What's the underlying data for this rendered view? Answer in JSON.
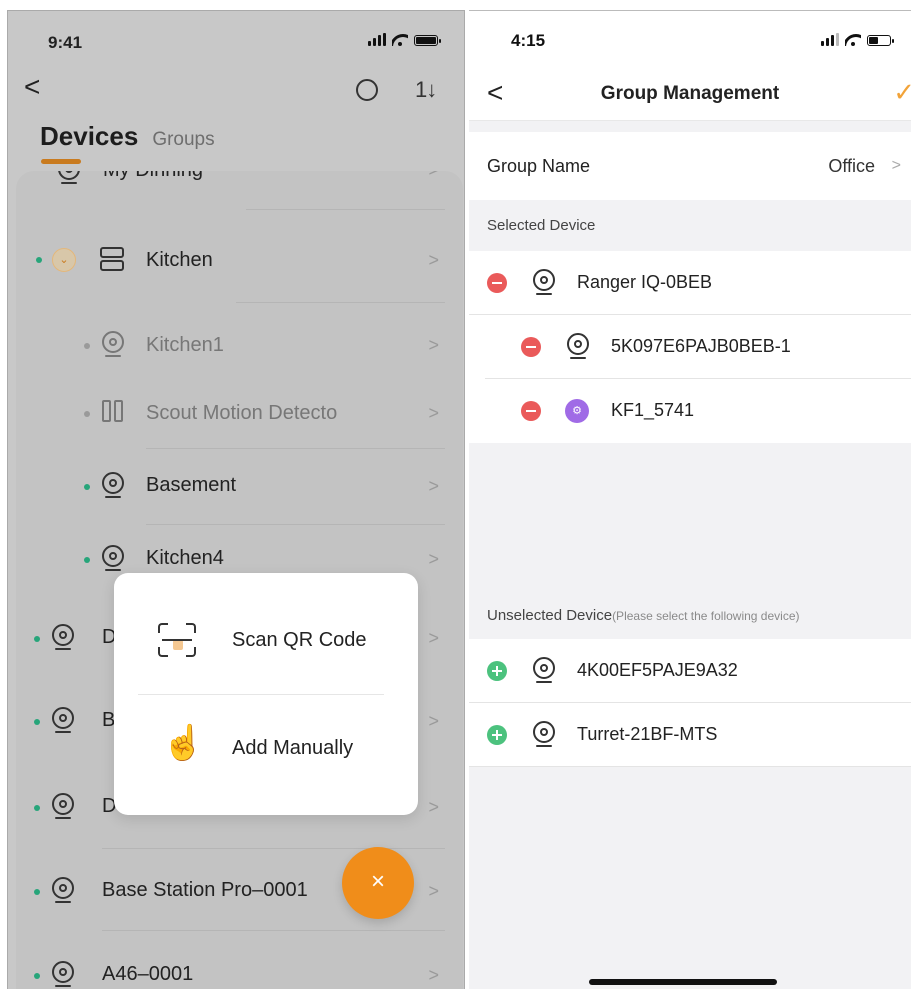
{
  "left": {
    "status": {
      "time": "9:41"
    },
    "nav": {
      "back": "<",
      "sort": "1↓"
    },
    "tabs": {
      "devices": "Devices",
      "groups": "Groups"
    },
    "partial_top_row": "My Dinning",
    "rows": [
      {
        "label": "Kitchen"
      },
      {
        "label": "Kitchen1"
      },
      {
        "label": "Scout Motion Detecto"
      },
      {
        "label": "Basement"
      },
      {
        "label": "Kitchen4"
      },
      {
        "label": "Do"
      },
      {
        "label": "Ba"
      },
      {
        "label": "Do"
      },
      {
        "label": "Base Station Pro–0001"
      },
      {
        "label": "A46–0001"
      }
    ],
    "popup": {
      "scan": "Scan QR Code",
      "manual": "Add Manually"
    },
    "fab": "×"
  },
  "right": {
    "status": {
      "time": "4:15"
    },
    "nav": {
      "back": "<",
      "title": "Group Management",
      "confirm": "✓"
    },
    "group_name": {
      "label": "Group Name",
      "value": "Office",
      "chevron": ">"
    },
    "selected": {
      "heading": "Selected Device",
      "devices": [
        {
          "name": "Ranger IQ-0BEB"
        },
        {
          "name": "5K097E6PAJB0BEB-1"
        },
        {
          "name": "KF1_5741"
        }
      ]
    },
    "unselected": {
      "heading": "Unselected Device",
      "hint": "(Please select the following device)",
      "devices": [
        {
          "name": "4K00EF5PAJE9A32"
        },
        {
          "name": "Turret-21BF-MTS"
        }
      ]
    }
  },
  "colors": {
    "accent_orange": "#f08d1a",
    "online_green": "#27a57a",
    "remove_red": "#ea5a5a",
    "add_green": "#4cc27e"
  }
}
